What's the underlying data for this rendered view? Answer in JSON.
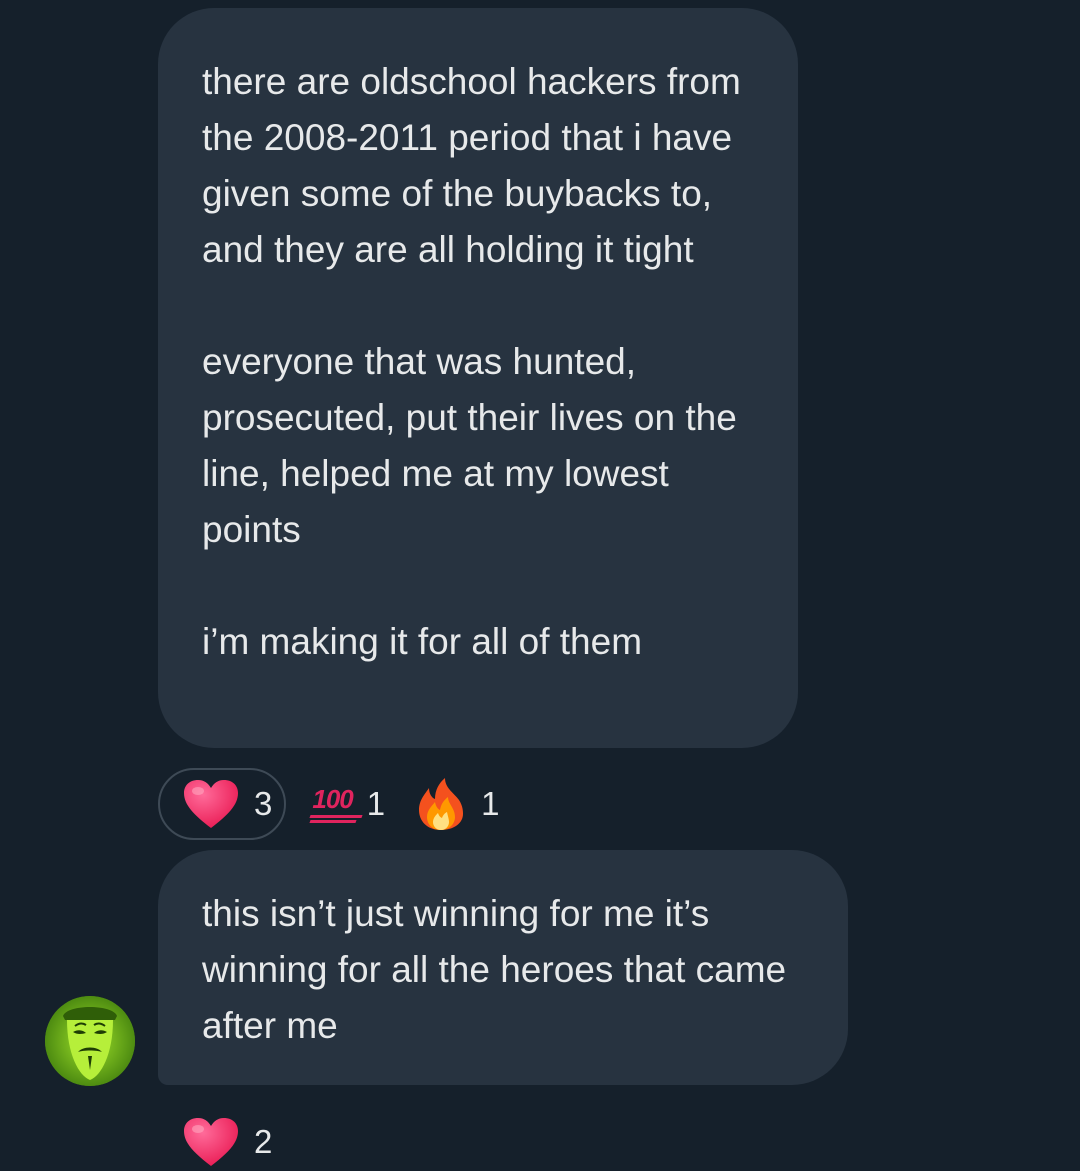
{
  "messages": [
    {
      "paragraphs": [
        "there are oldschool hackers from the 2008-2011 period that i have given some of the buybacks to, and they are all holding it tight",
        "everyone that was hunted, prosecuted, put their lives on the line, helped me at my lowest points",
        "i’m making it for all of them"
      ],
      "reactions": [
        {
          "emoji": "heart-emoji",
          "count": "3",
          "selected": true
        },
        {
          "emoji": "hundred-points-emoji",
          "count": "1",
          "selected": false
        },
        {
          "emoji": "fire-emoji",
          "count": "1",
          "selected": false
        }
      ]
    },
    {
      "paragraphs": [
        "this isn’t just winning for me it’s winning for all the heroes that came after me"
      ],
      "reactions": [
        {
          "emoji": "heart-emoji",
          "count": "2",
          "selected": false
        }
      ]
    }
  ],
  "hundred_emoji_text": "100",
  "avatar": {
    "icon": "guy-fawkes-mask-icon"
  },
  "colors": {
    "background": "#15202b",
    "bubble": "#273340",
    "text": "#e7e9ea",
    "heart": "#f91880"
  }
}
